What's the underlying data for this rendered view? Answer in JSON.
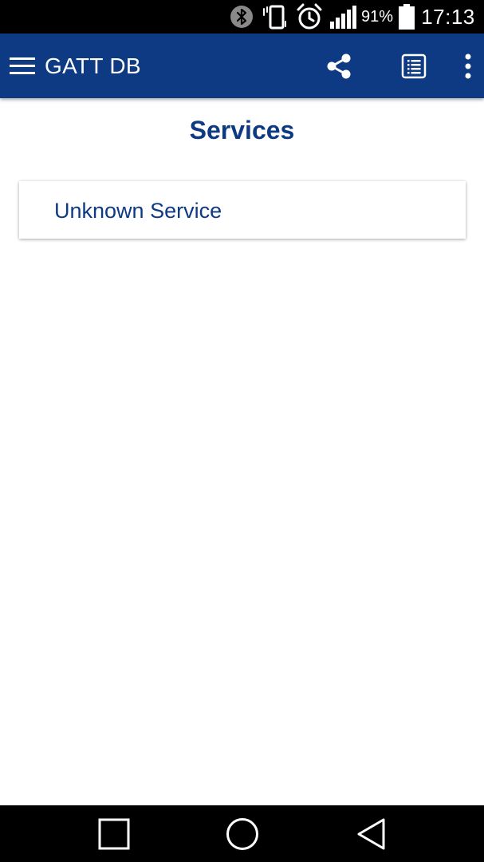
{
  "status_bar": {
    "battery_percent": "91%",
    "time": "17:13",
    "icons": [
      "bluetooth-icon",
      "vibrate-icon",
      "alarm-icon",
      "signal-icon",
      "battery-icon"
    ]
  },
  "toolbar": {
    "title": "GATT DB",
    "icons": [
      "menu-icon",
      "share-icon",
      "log-icon",
      "more-vert-icon"
    ],
    "background_color": "#0d3a82"
  },
  "main": {
    "section_title": "Services",
    "services": [
      {
        "name": "Unknown Service"
      }
    ],
    "text_color": "#0d3a82"
  },
  "nav_bar": {
    "icons": [
      "recents-square-icon",
      "home-circle-icon",
      "back-triangle-icon"
    ]
  }
}
